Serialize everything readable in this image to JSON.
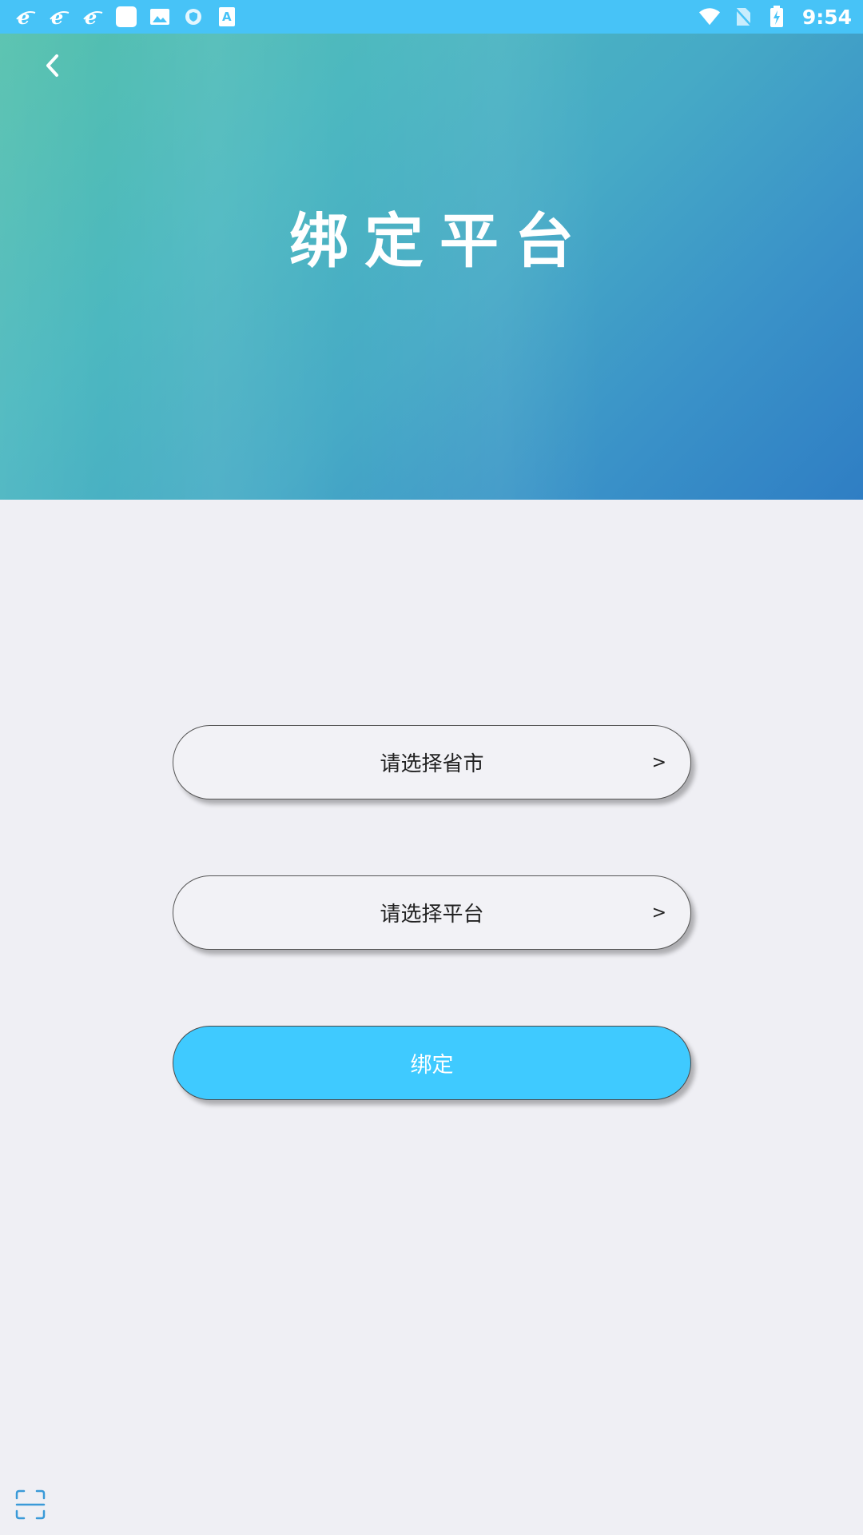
{
  "status_bar": {
    "time": "9:54",
    "left_icons": [
      "ie-browser-icon",
      "ie-browser-icon",
      "ie-browser-icon",
      "blank-app-icon",
      "image-icon",
      "shield-icon",
      "font-app-icon"
    ],
    "right_icons": [
      "wifi-icon",
      "no-sim-icon",
      "battery-charging-icon"
    ]
  },
  "header": {
    "title": "绑定平台"
  },
  "form": {
    "province_select_label": "请选择省市",
    "platform_select_label": "请选择平台",
    "chevron": ">",
    "bind_button_label": "绑定"
  },
  "colors": {
    "status_bar": "#47c3f7",
    "bind_button": "#3fcaff",
    "background": "#efeff4",
    "hero_start": "#55c1ad",
    "hero_end": "#2f7ec4"
  }
}
